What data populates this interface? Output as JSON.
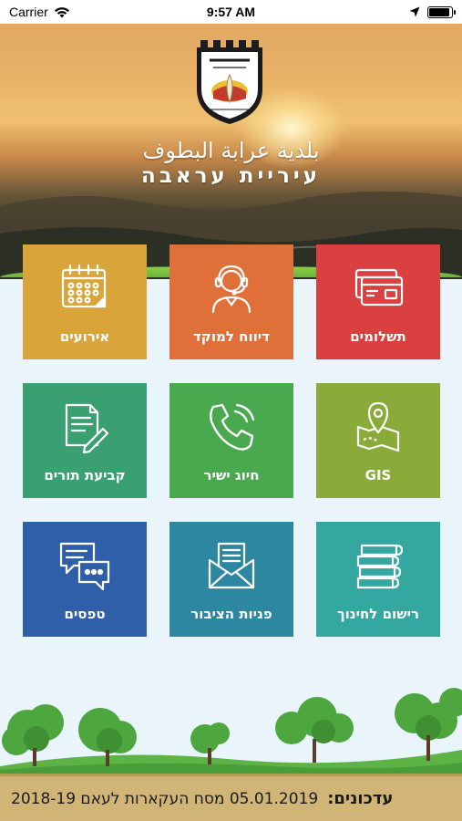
{
  "status": {
    "carrier": "Carrier",
    "time": "9:57 AM",
    "battery_level": 0.9
  },
  "header": {
    "title_arabic": "بلدية عرابة البطوف",
    "title_hebrew": "עיריית עראבה"
  },
  "tiles": [
    {
      "label": "תשלומים",
      "icon": "credit-card-icon",
      "color": "#d9403f"
    },
    {
      "label": "דיווח למוקד",
      "icon": "headset-agent-icon",
      "color": "#e0703a"
    },
    {
      "label": "אירועים",
      "icon": "calendar-icon",
      "color": "#d9a53a"
    },
    {
      "label": "GIS",
      "icon": "map-pin-icon",
      "color": "#8aab3a"
    },
    {
      "label": "חיוג ישיר",
      "icon": "phone-icon",
      "color": "#4aa84e"
    },
    {
      "label": "קביעת תורים",
      "icon": "document-pen-icon",
      "color": "#3aa071"
    },
    {
      "label": "רישום לחינוך",
      "icon": "books-icon",
      "color": "#34a7a1"
    },
    {
      "label": "פניות הציבור",
      "icon": "envelope-letter-icon",
      "color": "#2e87a0"
    },
    {
      "label": "טפסים",
      "icon": "chat-bubbles-icon",
      "color": "#2f5fa8"
    }
  ],
  "ticker": {
    "label": "עדכונים:",
    "text": "05.01.2019 מסח העקארות לעאם 2018-19"
  }
}
